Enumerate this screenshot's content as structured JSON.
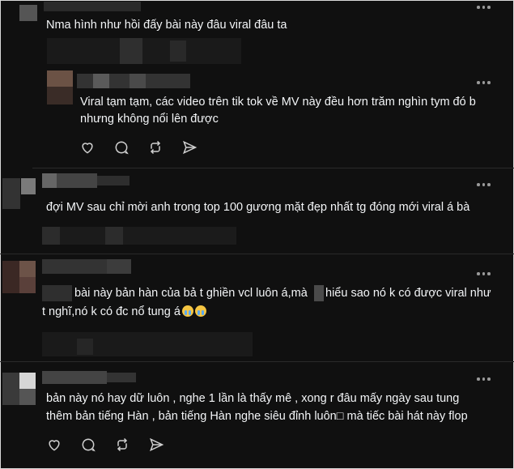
{
  "comments": [
    {
      "text": "Nma hình như hồi đấy bài này đâu viral đâu ta"
    },
    {
      "text_lines": [
        "Viral tạm tạm, các video trên tik tok về MV này đều hơn trăm nghìn tym đó b",
        "nhưng không nổi lên được"
      ]
    },
    {
      "text": "đợi MV sau chỉ mời anh trong top 100 gương mặt đẹp nhất tg đóng mới viral á bà"
    },
    {
      "text_lines": [
        "bài này bản hàn của bả t ghiền vcl luôn á,mà",
        "hiểu sao nó k có được viral như",
        "t nghĩ,nó k có đc nổ tung á"
      ]
    },
    {
      "text_lines": [
        "bản này nó hay dữ luôn , nghe 1 lần là thấy mê , xong r đâu mấy ngày sau tung",
        "thêm bản tiếng Hàn , bản tiếng Hàn nghe siêu đỉnh luôn□ mà tiếc bài hát này flop"
      ]
    }
  ],
  "icons": {
    "like": "heart-icon",
    "comment": "comment-icon",
    "repost": "repost-icon",
    "share": "share-icon",
    "more": "more-icon",
    "emoji": "crying-face-emoji"
  }
}
